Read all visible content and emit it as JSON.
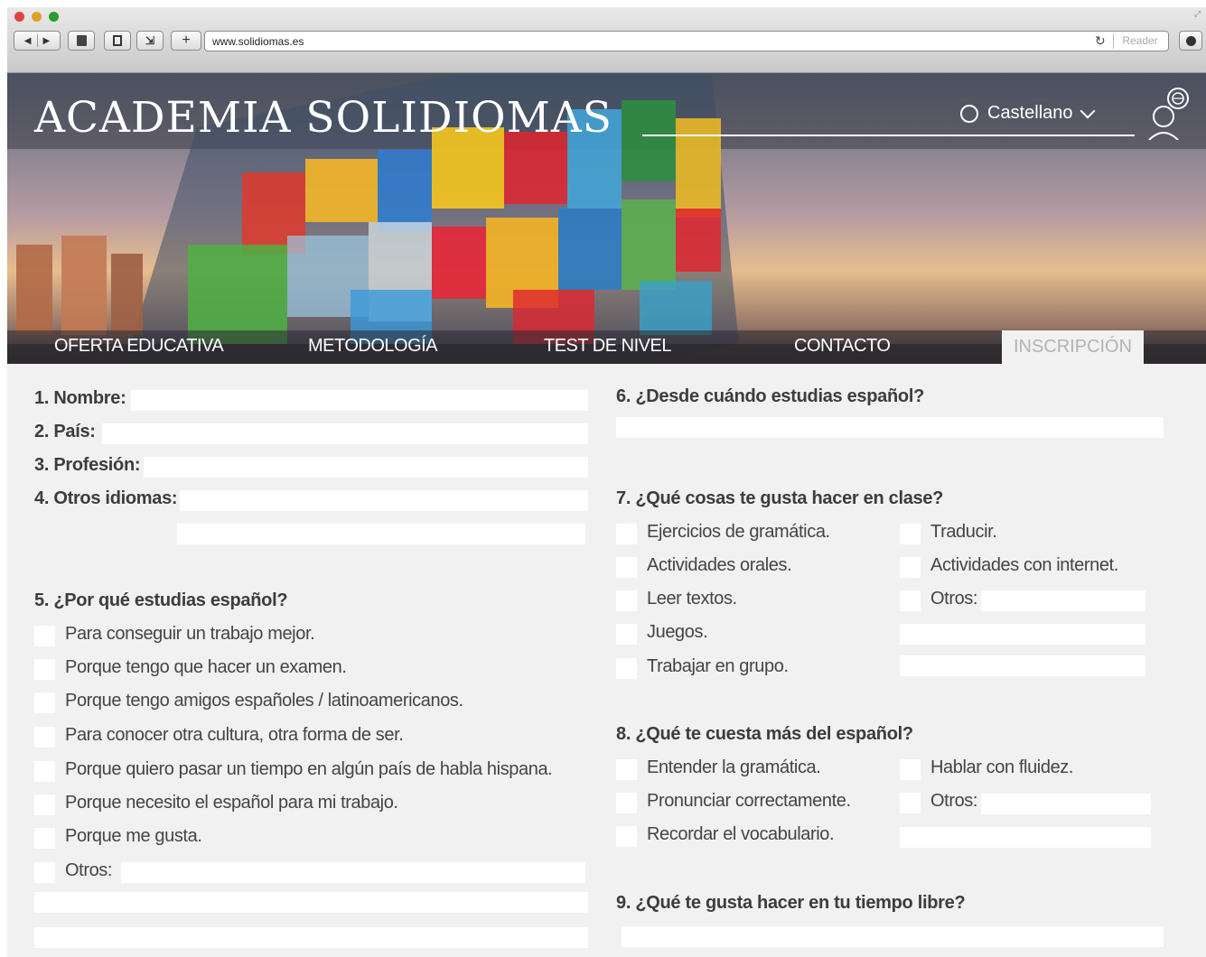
{
  "browser": {
    "url": "www.solidiomas.es",
    "reader_label": "Reader"
  },
  "header": {
    "title": "ACADEMIA SOLIDIOMAS",
    "language": "Castellano"
  },
  "nav": {
    "items": [
      "OFERTA EDUCATIVA",
      "METODOLOGÍA",
      "TEST DE NIVEL",
      "CONTACTO"
    ],
    "active": "INSCRIPCIÓN"
  },
  "form": {
    "q1": "1. Nombre:",
    "q2": "2. País:",
    "q3": "3. Profesión:",
    "q4": "4. Otros idiomas:",
    "q5": "5. ¿Por qué estudias español?",
    "q5_options": [
      "Para conseguir un trabajo mejor.",
      "Porque tengo que hacer un examen.",
      "Porque tengo amigos españoles / latinoamericanos.",
      "Para conocer otra cultura, otra forma de ser.",
      "Porque quiero pasar un tiempo en algún país de habla hispana.",
      "Porque necesito el español para mi trabajo.",
      "Porque me gusta.",
      "Otros:"
    ],
    "q6": "6. ¿Desde cuándo estudias español?",
    "q7": "7. ¿Qué cosas te gusta hacer en clase?",
    "q7_left": [
      "Ejercicios de gramática.",
      "Actividades orales.",
      "Leer textos.",
      "Juegos.",
      "Trabajar en grupo."
    ],
    "q7_right": [
      "Traducir.",
      "Actividades con internet.",
      "Otros:"
    ],
    "q8": "8. ¿Qué te cuesta más del español?",
    "q8_left": [
      "Entender la gramática.",
      "Pronunciar correctamente.",
      "Recordar el vocabulario."
    ],
    "q8_right": [
      "Hablar con fluidez.",
      "Otros:"
    ],
    "q9": "9. ¿Qué te gusta hacer en tu tiempo libre?"
  }
}
